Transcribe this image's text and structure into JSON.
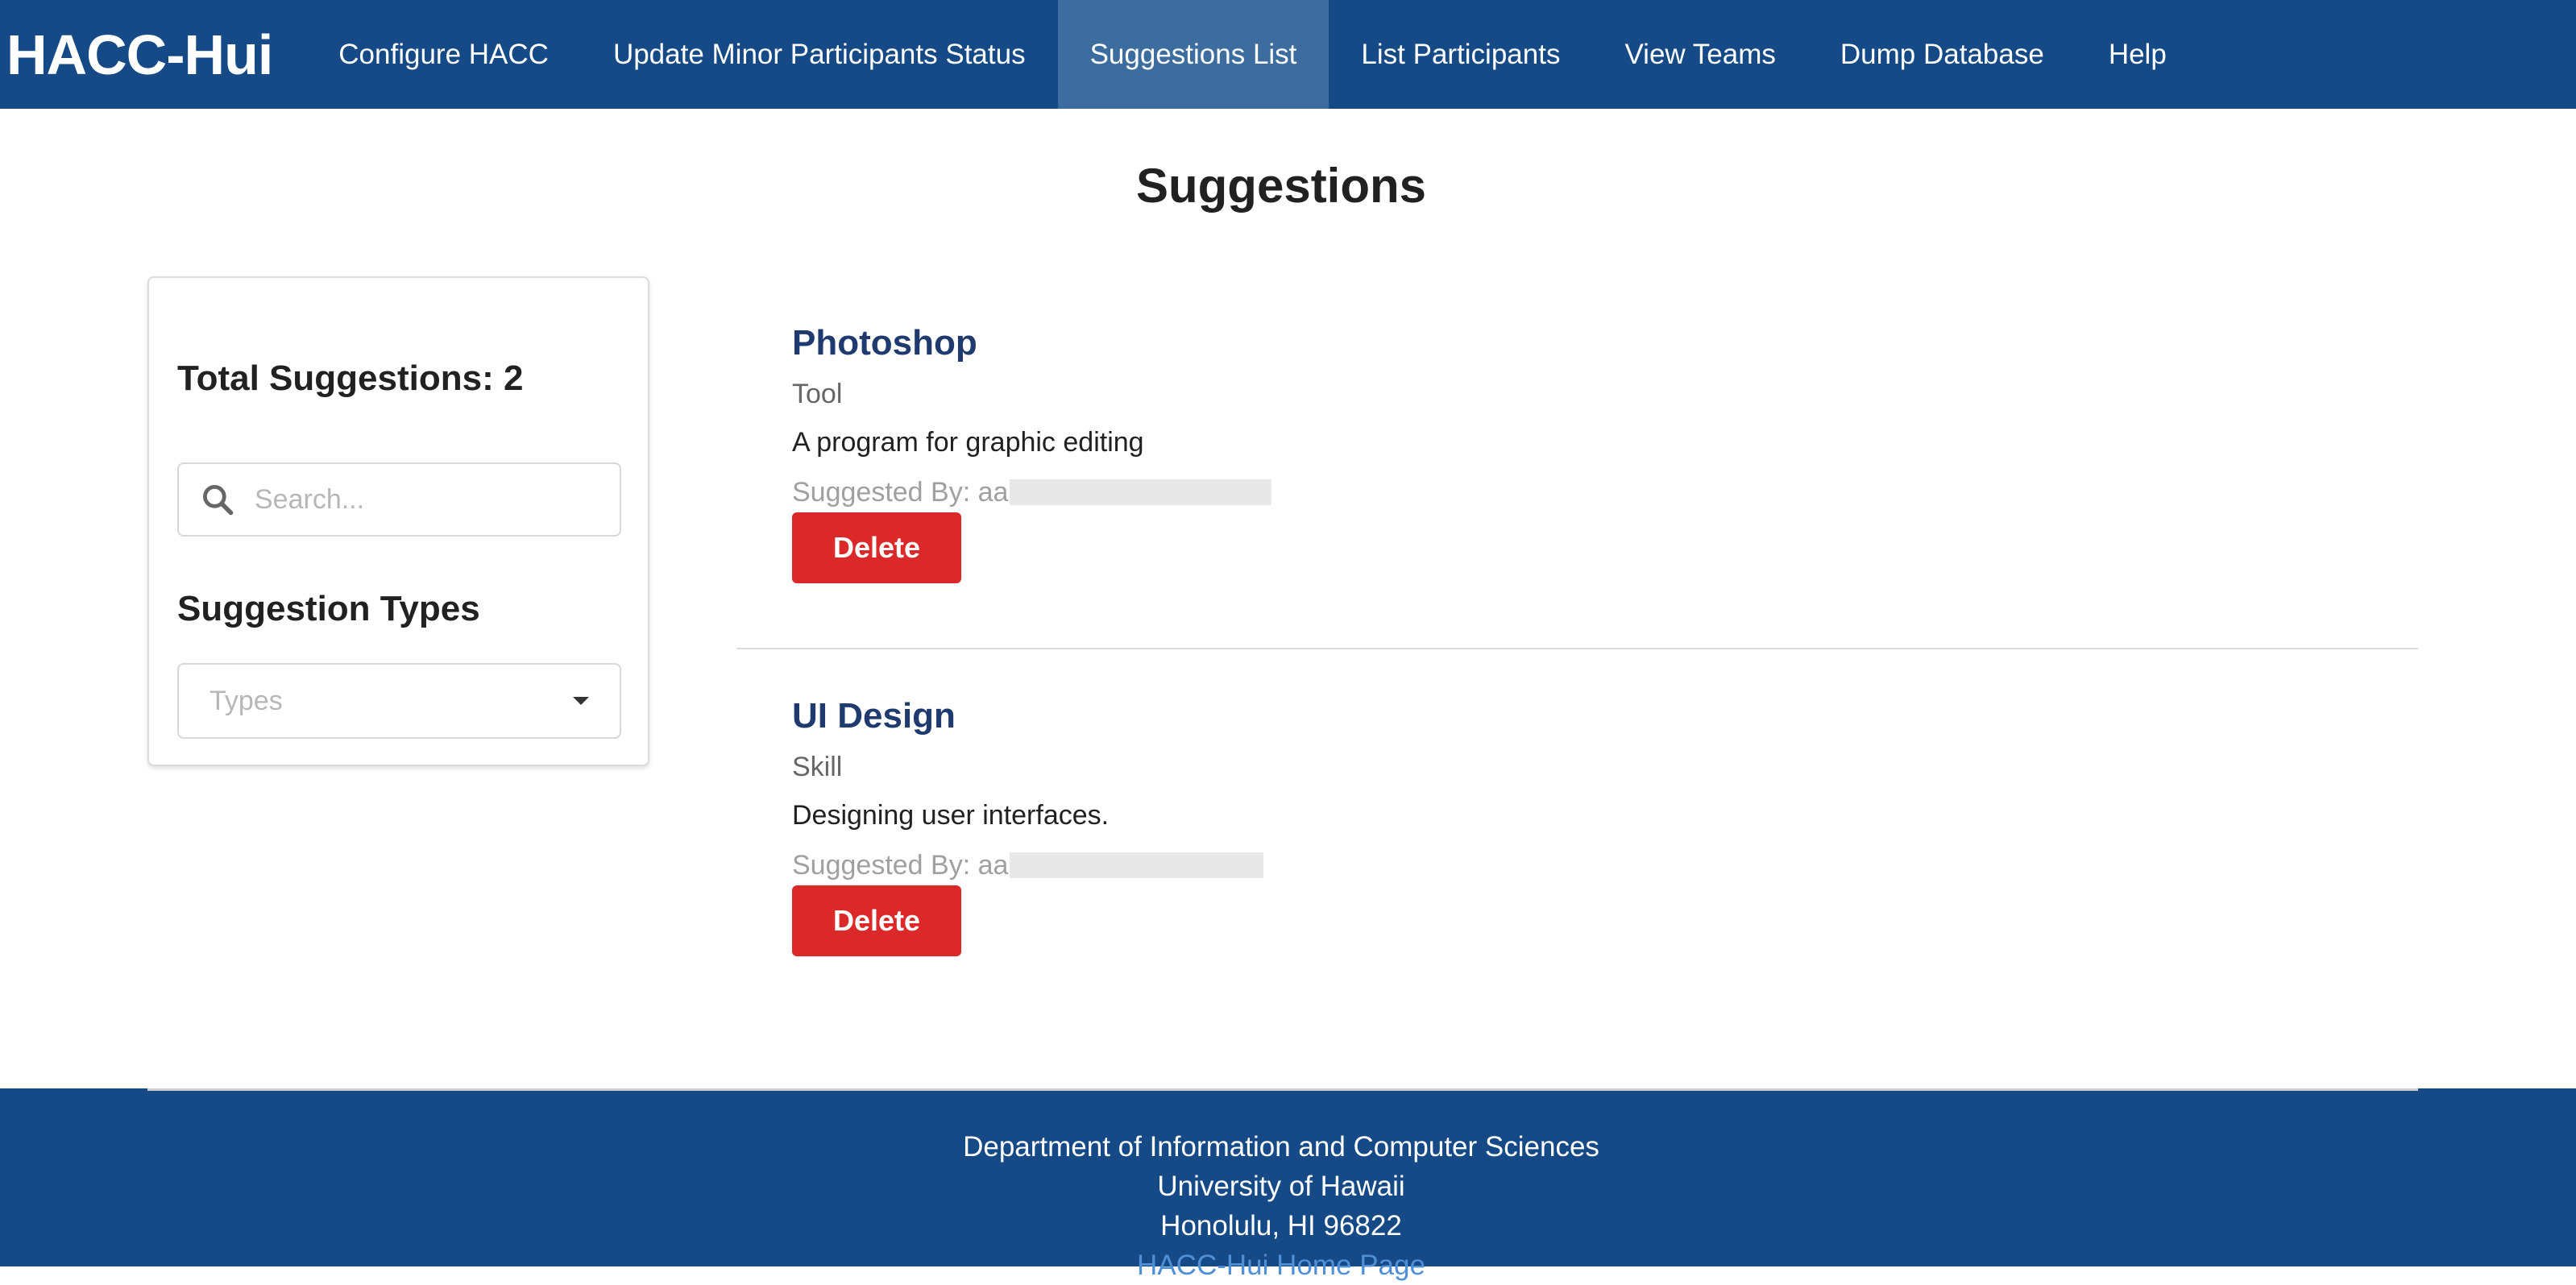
{
  "nav": {
    "brand": "HACC-Hui",
    "items": [
      {
        "label": "Configure HACC"
      },
      {
        "label": "Update Minor Participants Status"
      },
      {
        "label": "Suggestions List",
        "active": true
      },
      {
        "label": "List Participants"
      },
      {
        "label": "View Teams"
      },
      {
        "label": "Dump Database"
      },
      {
        "label": "Help"
      }
    ]
  },
  "page": {
    "title": "Suggestions"
  },
  "sidebar": {
    "total_label": "Total Suggestions: 2",
    "search": {
      "placeholder": "Search...",
      "value": "",
      "icon": "search-icon"
    },
    "types_heading": "Suggestion Types",
    "types_select": {
      "placeholder": "Types",
      "icon": "chevron-down-icon"
    }
  },
  "suggestions": [
    {
      "title": "Photoshop",
      "type": "Tool",
      "description": "A program for graphic editing",
      "suggested_by": "Suggested By: aa",
      "delete_label": "Delete"
    },
    {
      "title": "UI Design",
      "type": "Skill",
      "description": "Designing user interfaces.",
      "suggested_by": "Suggested By: aa",
      "delete_label": "Delete"
    }
  ],
  "footer": {
    "line1": "Department of Information and Computer Sciences",
    "line2": "University of Hawaii",
    "line3": "Honolulu, HI 96822",
    "link_label": "HACC-Hui Home Page"
  },
  "colors": {
    "navbar": "#154a86",
    "nav_active": "#3d6c9f",
    "delete": "#db2828",
    "title_link": "#1f3a6e"
  }
}
